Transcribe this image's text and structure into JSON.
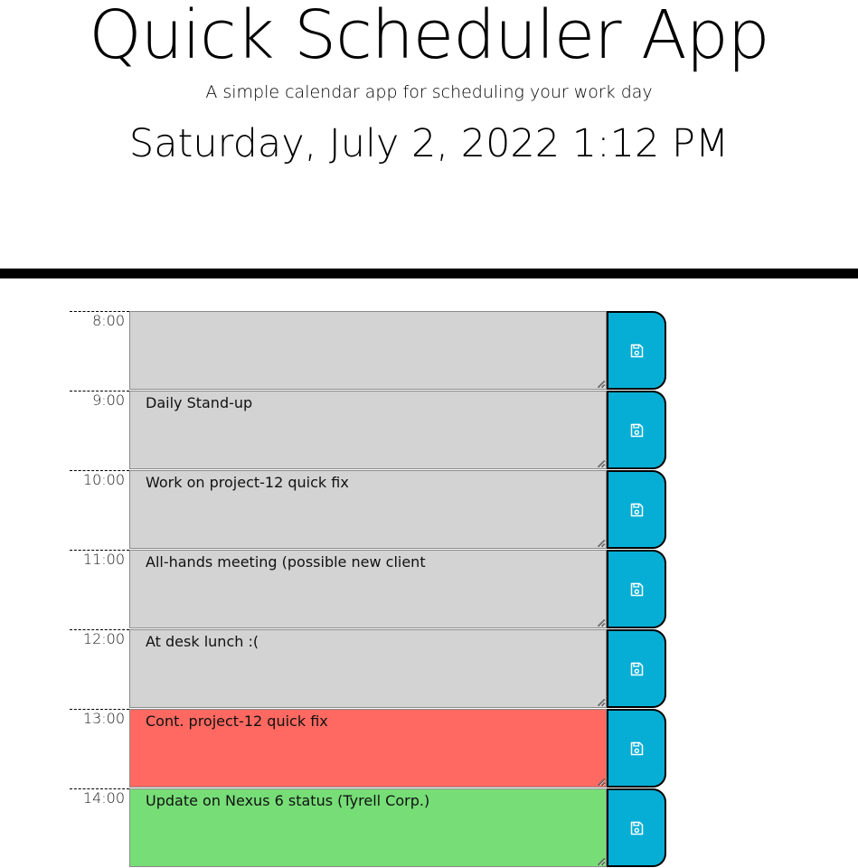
{
  "header": {
    "title": "Quick Scheduler App",
    "subtitle": "A simple calendar app for scheduling your work day",
    "current_day": "Saturday, July 2, 2022 1:12 PM"
  },
  "colors": {
    "past": "#d3d3d3",
    "present": "#ff6961",
    "future": "#77dd77",
    "save_button": "#06aed5"
  },
  "save_icon": "floppy-disk-icon",
  "timeblocks": [
    {
      "hour": "8:00",
      "text": "",
      "status": "past"
    },
    {
      "hour": "9:00",
      "text": "Daily Stand-up",
      "status": "past"
    },
    {
      "hour": "10:00",
      "text": "Work on project-12 quick fix",
      "status": "past"
    },
    {
      "hour": "11:00",
      "text": "All-hands meeting (possible new client",
      "status": "past"
    },
    {
      "hour": "12:00",
      "text": "At desk lunch :(",
      "status": "past"
    },
    {
      "hour": "13:00",
      "text": "Cont. project-12 quick fix",
      "status": "present"
    },
    {
      "hour": "14:00",
      "text": "Update on Nexus 6 status (Tyrell Corp.)",
      "status": "future"
    }
  ]
}
